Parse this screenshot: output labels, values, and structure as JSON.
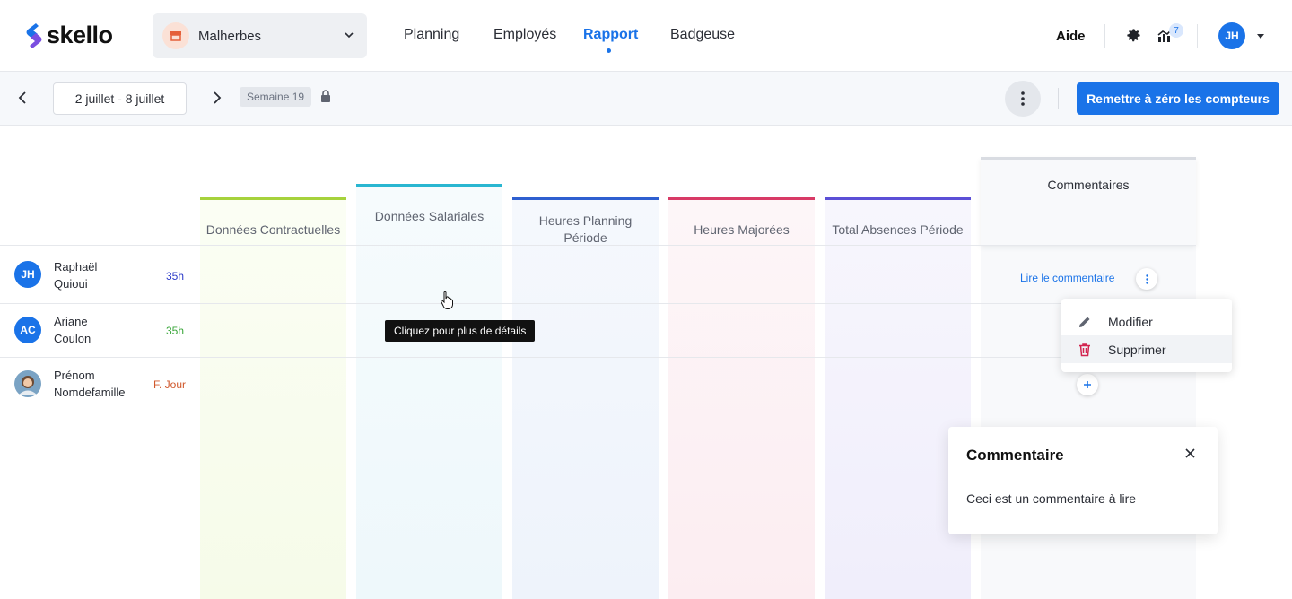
{
  "app": {
    "name": "skello",
    "brand_color": "#1a73e8"
  },
  "shop_selector": {
    "label": "Malherbes"
  },
  "nav": {
    "items": [
      "Planning",
      "Employés",
      "Rapport",
      "Badgeuse"
    ],
    "active": "Rapport"
  },
  "header_right": {
    "help_label": "Aide",
    "notification_count": "7",
    "user_initials": "JH"
  },
  "toolbar": {
    "date_range": "2 juillet - 8 juillet",
    "week_label": "Semaine 19",
    "reset_button": "Remettre à zéro les compteurs"
  },
  "columns": [
    {
      "label": "Données Contractuelles",
      "color": "#a6d23c"
    },
    {
      "label": "Données Salariales",
      "color": "#29b6d1"
    },
    {
      "label": "Heures Planning Période",
      "color": "#2e5fd0"
    },
    {
      "label": "Heures Majorées",
      "color": "#d83a66"
    },
    {
      "label": "Total Absences Période",
      "color": "#5b4fd6"
    }
  ],
  "comments_column": {
    "label": "Commentaires",
    "read_link": "Lire le commentaire"
  },
  "employees": [
    {
      "initials": "JH",
      "first_name": "Raphaël",
      "last_name": "Quioui",
      "hours": "35h",
      "hours_color": "#2e3cc9"
    },
    {
      "initials": "AC",
      "first_name": "Ariane",
      "last_name": "Coulon",
      "hours": "35h",
      "hours_color": "#3aa63a"
    },
    {
      "initials": "",
      "first_name": "Prénom",
      "last_name": "Nomdefamille",
      "hours": "F. Jour",
      "hours_color": "#d0582c"
    }
  ],
  "context_menu": {
    "edit": "Modifier",
    "delete": "Supprimer"
  },
  "tooltip": "Cliquez pour plus de détails",
  "comment_modal": {
    "title": "Commentaire",
    "body": "Ceci est un commentaire à lire"
  }
}
